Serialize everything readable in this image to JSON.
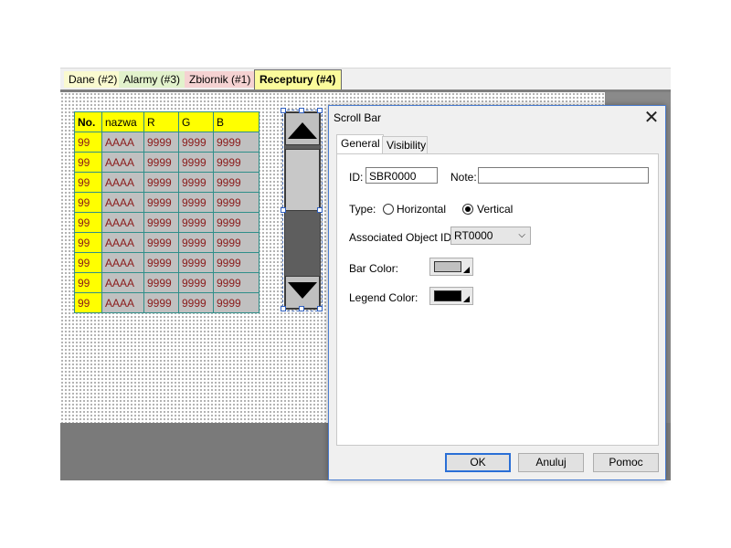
{
  "page_tabs": [
    {
      "label": "Dane (#2)"
    },
    {
      "label": "Alarmy (#3)"
    },
    {
      "label": "Zbiornik (#1)"
    },
    {
      "label": "Receptury (#4)",
      "active": true
    }
  ],
  "recipe_table": {
    "columns": [
      "No.",
      "nazwa",
      "R",
      "G",
      "B"
    ],
    "rows": [
      [
        "99",
        "AAAA",
        "9999",
        "9999",
        "9999"
      ],
      [
        "99",
        "AAAA",
        "9999",
        "9999",
        "9999"
      ],
      [
        "99",
        "AAAA",
        "9999",
        "9999",
        "9999"
      ],
      [
        "99",
        "AAAA",
        "9999",
        "9999",
        "9999"
      ],
      [
        "99",
        "AAAA",
        "9999",
        "9999",
        "9999"
      ],
      [
        "99",
        "AAAA",
        "9999",
        "9999",
        "9999"
      ],
      [
        "99",
        "AAAA",
        "9999",
        "9999",
        "9999"
      ],
      [
        "99",
        "AAAA",
        "9999",
        "9999",
        "9999"
      ],
      [
        "99",
        "AAAA",
        "9999",
        "9999",
        "9999"
      ]
    ]
  },
  "scrollbar_widget": {
    "up_icon": "triangle-up-icon",
    "down_icon": "triangle-down-icon"
  },
  "dialog": {
    "title": "Scroll Bar",
    "close_icon": "close-icon",
    "tabs": [
      "General",
      "Visibility"
    ],
    "id_label": "ID:",
    "id_value": "SBR0000",
    "note_label": "Note:",
    "note_value": "",
    "type_label": "Type:",
    "type_horizontal": "Horizontal",
    "type_vertical": "Vertical",
    "type_selected": "Vertical",
    "assoc_label": "Associated Object ID:",
    "assoc_value": "RT0000",
    "bar_color_label": "Bar Color:",
    "bar_color": "#c0c0c0",
    "legend_color_label": "Legend Color:",
    "legend_color": "#000000",
    "ok": "OK",
    "cancel": "Anuluj",
    "help": "Pomoc"
  },
  "colors": {
    "header_yellow": "#ffff00",
    "cell_grey": "#c0c0c0",
    "cell_text": "#8b1a1a",
    "grid_teal": "#2f8f8a",
    "accent_blue": "#2a6fd6"
  }
}
